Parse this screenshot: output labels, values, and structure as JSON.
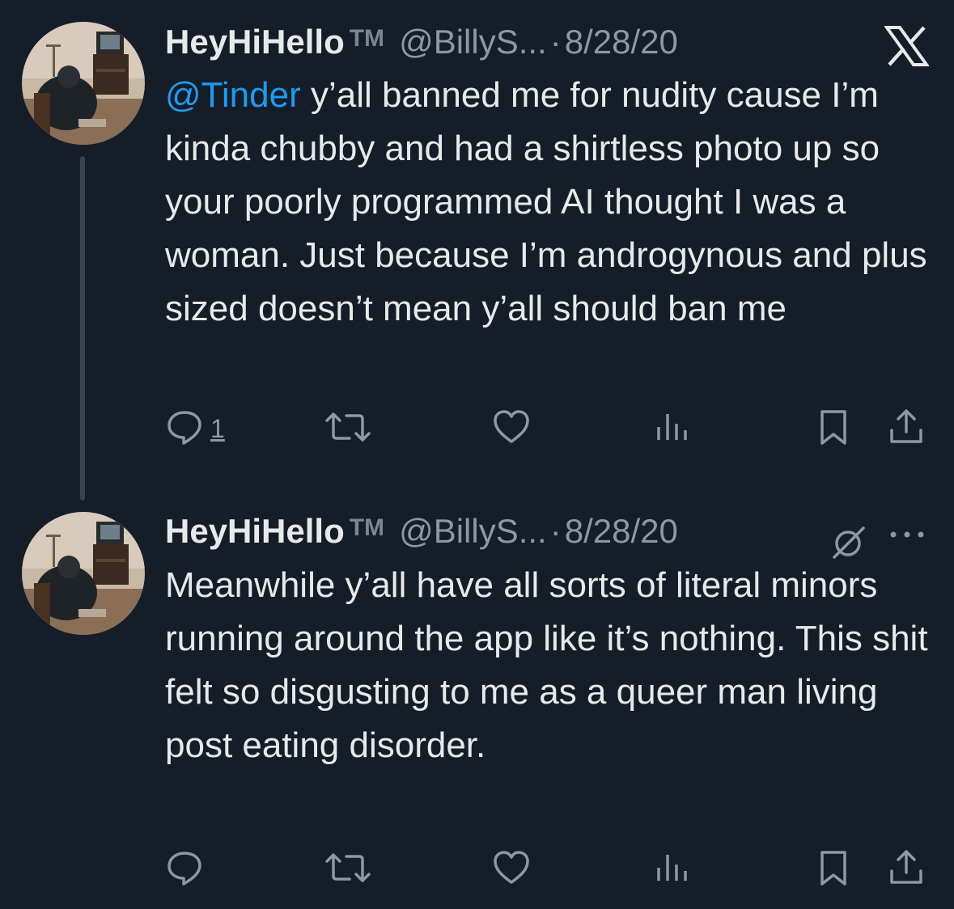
{
  "tweets": [
    {
      "display_name": "HeyHiHello",
      "badge": "TM",
      "handle": "@BillyS...",
      "separator": "·",
      "date": "8/28/20",
      "mention": "@Tinder",
      "text": " y’all banned me for nudity cause I’m kinda chubby and had a shirtless photo up so your poorly programmed AI thought I was a woman. Just because I’m androgynous and plus sized doesn’t mean y’all should ban me",
      "reply_count": "1",
      "header_icon": "x-logo-icon",
      "actions": [
        "reply-icon",
        "retweet-icon",
        "like-icon",
        "views-icon",
        "bookmark-icon",
        "share-icon"
      ]
    },
    {
      "display_name": "HeyHiHello",
      "badge": "TM",
      "handle": "@BillyS...",
      "separator": "·",
      "date": "8/28/20",
      "text": "Meanwhile y’all have all sorts of literal minors running around the app like it’s nothing. This shit felt so disgusting to me as a queer man living post eating disorder.",
      "header_icon": "hidden-reply-icon",
      "more_icon": "more-icon",
      "actions": [
        "reply-icon",
        "retweet-icon",
        "like-icon",
        "views-icon",
        "bookmark-icon",
        "share-icon"
      ]
    }
  ],
  "colors": {
    "background": "#151d28",
    "text": "#e7e9ea",
    "secondary": "#8b98a5",
    "accent": "#1d9bf0",
    "thread_line": "#38444d"
  }
}
